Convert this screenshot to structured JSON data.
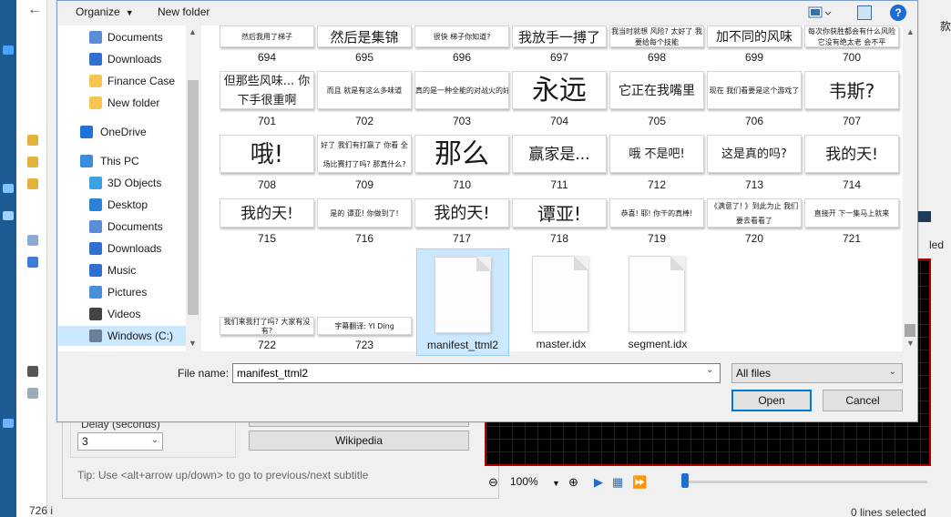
{
  "background": {
    "status_left": "726 i",
    "delay_label": "Delay (seconds)",
    "delay_value": "3",
    "wikipedia_button": "Wikipedia",
    "tip": "Tip: Use <alt+arrow up/down> to go to previous/next subtitle",
    "zoom_value": "100%",
    "status_right": "0 lines selected",
    "right_edge_text": "led",
    "right_top_text": "款"
  },
  "dialog": {
    "toolbar": {
      "organize": "Organize",
      "new_folder": "New folder",
      "help": "?"
    },
    "nav": [
      {
        "label": "Documents",
        "icon": "documents-icon",
        "color": "#5b8dd6"
      },
      {
        "label": "Downloads",
        "icon": "downloads-icon",
        "color": "#2f6fd1"
      },
      {
        "label": "Finance Case",
        "icon": "folder-icon",
        "color": "#f5c451"
      },
      {
        "label": "New folder",
        "icon": "folder-icon",
        "color": "#f5c451"
      },
      {
        "label": "OneDrive",
        "icon": "onedrive-icon",
        "color": "#1e73d8"
      },
      {
        "label": "This PC",
        "icon": "this-pc-icon",
        "color": "#3a8ddb"
      },
      {
        "label": "3D Objects",
        "icon": "3d-objects-icon",
        "color": "#3aa3e0"
      },
      {
        "label": "Desktop",
        "icon": "desktop-icon",
        "color": "#2b82d9"
      },
      {
        "label": "Documents",
        "icon": "documents-icon",
        "color": "#5b8dd6"
      },
      {
        "label": "Downloads",
        "icon": "downloads-icon",
        "color": "#2f6fd1"
      },
      {
        "label": "Music",
        "icon": "music-icon",
        "color": "#2f6fd1"
      },
      {
        "label": "Pictures",
        "icon": "pictures-icon",
        "color": "#4a90d9"
      },
      {
        "label": "Videos",
        "icon": "videos-icon",
        "color": "#444444"
      },
      {
        "label": "Windows (C:)",
        "icon": "drive-icon",
        "color": "#6a7f99"
      }
    ],
    "thumbnails": [
      {
        "number": "694",
        "text": "然后我用了梯子"
      },
      {
        "number": "695",
        "text": "然后是集锦"
      },
      {
        "number": "696",
        "text": "很快 梯子你知道?"
      },
      {
        "number": "697",
        "text": "我放手一搏了"
      },
      {
        "number": "698",
        "text": "我当时就想 风险? 太好了 我要给每个技能"
      },
      {
        "number": "699",
        "text": "加不同的风味"
      },
      {
        "number": "700",
        "text": "每次你获胜都会有什么风险 它没有绝太老 会不平"
      },
      {
        "number": "701",
        "text": "但那些风味... 你下手很重啊"
      },
      {
        "number": "702",
        "text": "而且 就是有这么多味道"
      },
      {
        "number": "703",
        "text": "真的是一种全能的对战火的好吧"
      },
      {
        "number": "704",
        "text": "永远"
      },
      {
        "number": "705",
        "text": "它正在我嘴里"
      },
      {
        "number": "706",
        "text": "现在 我们看要是这个游戏了"
      },
      {
        "number": "707",
        "text": "韦斯?"
      },
      {
        "number": "708",
        "text": "哦!"
      },
      {
        "number": "709",
        "text": "好了 我们有打赢了 你看 全场比赛打了吗? 那真什么?"
      },
      {
        "number": "710",
        "text": "那么"
      },
      {
        "number": "711",
        "text": "赢家是..."
      },
      {
        "number": "712",
        "text": "哦 不是吧!"
      },
      {
        "number": "713",
        "text": "这是真的吗?"
      },
      {
        "number": "714",
        "text": "我的天!"
      },
      {
        "number": "715",
        "text": "我的天!"
      },
      {
        "number": "716",
        "text": "是的 谭亚! 你做到了!"
      },
      {
        "number": "717",
        "text": "我的天!"
      },
      {
        "number": "718",
        "text": "谭亚!"
      },
      {
        "number": "719",
        "text": "恭喜! 耶! 你干的真棒!"
      },
      {
        "number": "720",
        "text": "《满意了! 》到此为止 我们要去看看了"
      },
      {
        "number": "721",
        "text": "直接开 下一集马上就来"
      },
      {
        "number": "722",
        "text": "我们来我打了吗? 大家有没有?"
      },
      {
        "number": "723",
        "text": "字幕翻译: YI Ding"
      }
    ],
    "files": [
      {
        "name": "manifest_ttml2",
        "selected": true
      },
      {
        "name": "master.idx",
        "selected": false
      },
      {
        "name": "segment.idx",
        "selected": false
      }
    ],
    "filename_label": "File name:",
    "filename_value": "manifest_ttml2",
    "filetype": "All files",
    "open": "Open",
    "cancel": "Cancel"
  }
}
